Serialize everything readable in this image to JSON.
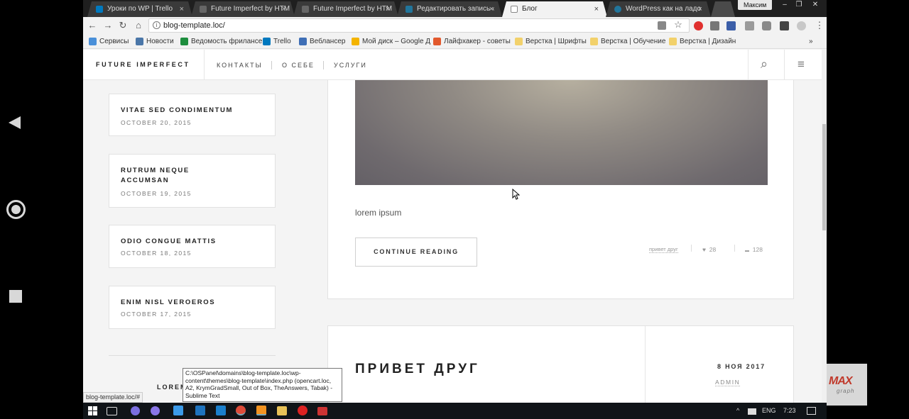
{
  "browser": {
    "tabs": [
      {
        "title": "Уроки по WP | Trello",
        "active": false
      },
      {
        "title": "Future Imperfect by HTM",
        "active": false
      },
      {
        "title": "Future Imperfect by HTM",
        "active": false
      },
      {
        "title": "Редактировать запись ‹",
        "active": false
      },
      {
        "title": "Блог",
        "active": true
      },
      {
        "title": "WordPress как на ладо",
        "active": false
      }
    ],
    "tab_close_glyph": "×",
    "user_name": "Максим",
    "window_buttons": [
      "–",
      "❐",
      "✕"
    ],
    "url": "blog-template.loc/",
    "info_glyph": "i",
    "nav_glyphs": {
      "back": "←",
      "forward": "→",
      "reload": "↻",
      "home": "⌂",
      "star": "☆",
      "menu": "⋮"
    },
    "bookmarks": [
      {
        "label": "Сервисы",
        "color": "#4a90d9"
      },
      {
        "label": "Новости",
        "color": "#4a76a8"
      },
      {
        "label": "Ведомость фрилансе",
        "color": "#1e8e3e"
      },
      {
        "label": "Trello",
        "color": "#0079bf"
      },
      {
        "label": "Веблансер",
        "color": "#3f6fb6"
      },
      {
        "label": "Мой диск – Google Д",
        "color": "#f4b400"
      },
      {
        "label": "Лайфхакер - советы",
        "color": "#e2592d"
      },
      {
        "label": "Верстка | Шрифты",
        "color": "#f2d16b"
      },
      {
        "label": "Верстка | Обучение",
        "color": "#f2d16b"
      },
      {
        "label": "Верстка | Дизайн",
        "color": "#f2d16b"
      }
    ],
    "bookmarks_more": "»",
    "status_url": "blog-template.loc/#"
  },
  "site": {
    "logo": "FUTURE IMPERFECT",
    "nav": [
      "КОНТАКТЫ",
      "О СЕБЕ",
      "УСЛУГИ"
    ],
    "search_glyph": "⌕",
    "menu_glyph": "≡"
  },
  "sidebar": {
    "posts": [
      {
        "title": "VITAE SED CONDIMENTUM",
        "date": "OCTOBER 20, 2015"
      },
      {
        "title": "RUTRUM NEQUE ACCUMSAN",
        "date": "OCTOBER 19, 2015"
      },
      {
        "title": "ODIO CONGUE MATTIS",
        "date": "OCTOBER 18, 2015"
      },
      {
        "title": "ENIM NISL VEROEROS",
        "date": "OCTOBER 17, 2015"
      }
    ],
    "section_label": "LOREM"
  },
  "post": {
    "excerpt": "lorem ipsum",
    "continue_label": "CONTINUE READING",
    "category": "привет друг",
    "likes": "28",
    "comments": "128",
    "like_glyph": "♥",
    "comment_glyph": "▬"
  },
  "post2": {
    "title": "ПРИВЕТ ДРУГ",
    "date": "8 НОЯ 2017",
    "author": "ADMIN"
  },
  "tooltip": "C:\\OSPanel\\domains\\blog-template.loc\\wp-content\\themes\\blog-template\\index.php (opencart.loc, A2, KrymGradSmall, Out of Box, TheAnswers, Tabak) - Sublime Text",
  "taskbar": {
    "language": "ENG",
    "time": "7:23",
    "tray_arrow": "^"
  },
  "watermark": {
    "text": "MAX",
    "sub": "graph"
  },
  "colors": {
    "accent": "#2ebaae",
    "taskbar": "#101418"
  }
}
